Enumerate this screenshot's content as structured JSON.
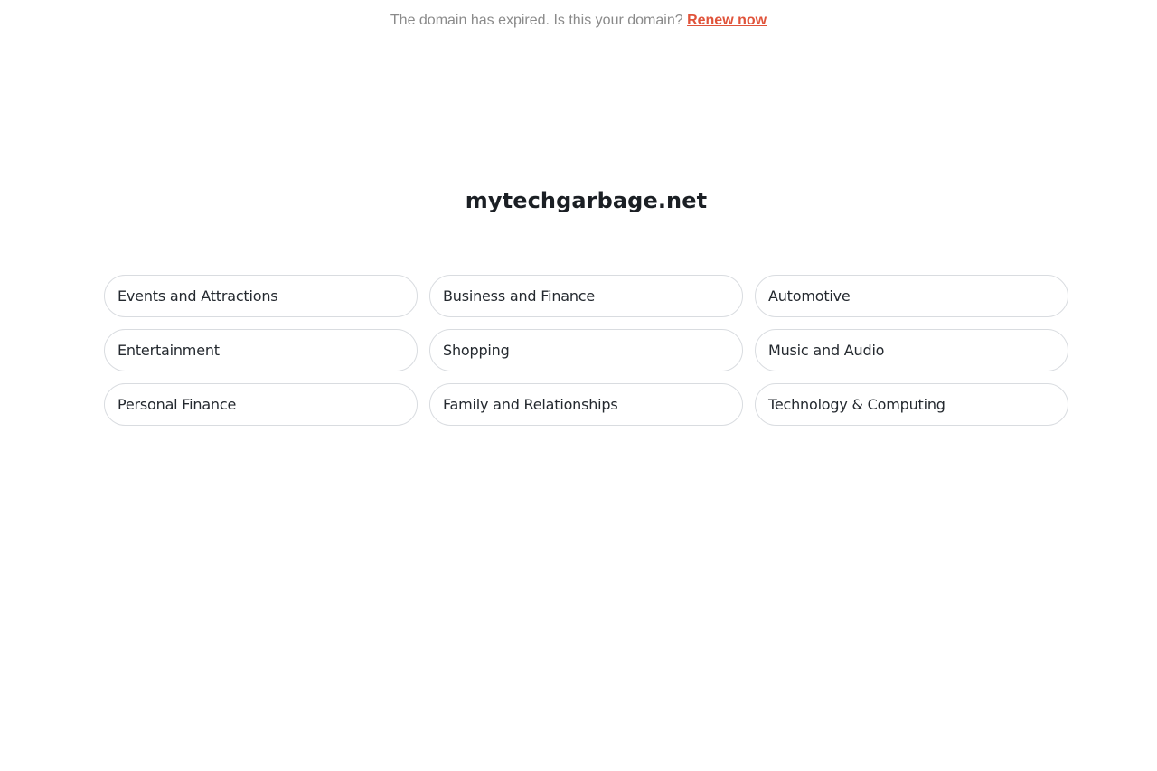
{
  "banner": {
    "message": "The domain has expired. Is this your domain?",
    "renew_label": "Renew now",
    "renew_color": "#e0533a"
  },
  "domain": {
    "name": "mytechgarbage.net"
  },
  "related_links": [
    {
      "label": "Events and Attractions"
    },
    {
      "label": "Business and Finance"
    },
    {
      "label": "Automotive"
    },
    {
      "label": "Entertainment"
    },
    {
      "label": "Shopping"
    },
    {
      "label": "Music and Audio"
    },
    {
      "label": "Personal Finance"
    },
    {
      "label": "Family and Relationships"
    },
    {
      "label": "Technology & Computing"
    }
  ]
}
